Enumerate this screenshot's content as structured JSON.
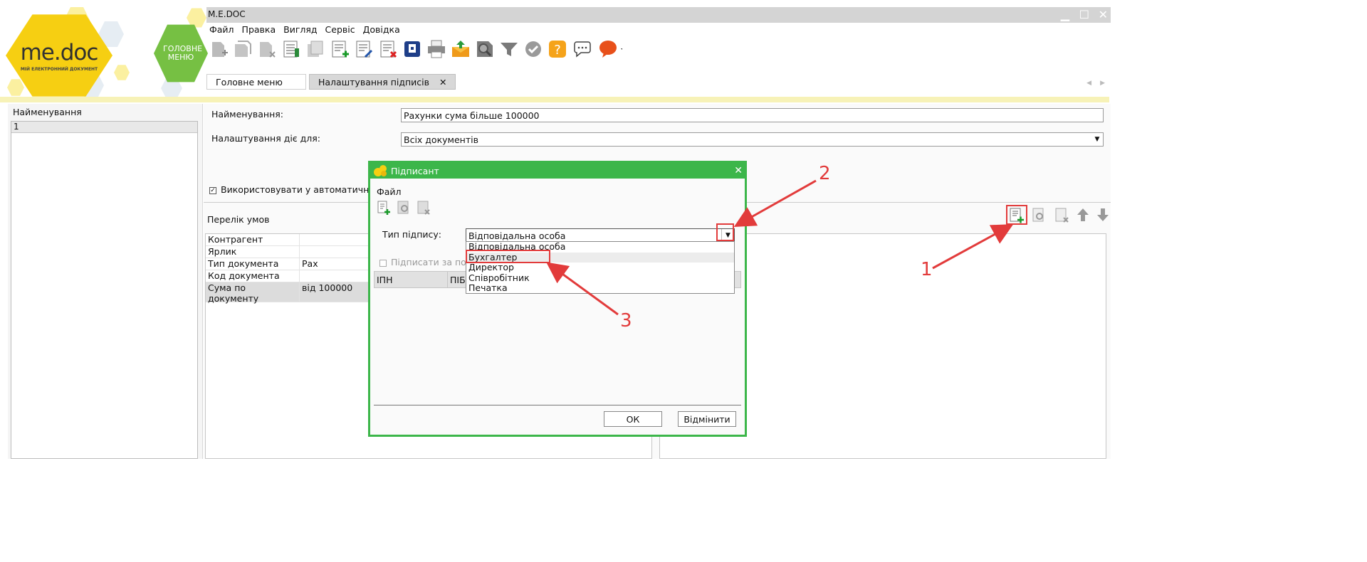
{
  "app": {
    "title": "M.E.DOC",
    "logo_text_me": "me",
    "logo_text_doc": "doc",
    "logo_subtitle": "МІЙ ЕЛЕКТРОННИЙ ДОКУМЕНТ",
    "home_button": "ГОЛОВНЕ МЕНЮ"
  },
  "menu": [
    "Файл",
    "Правка",
    "Вигляд",
    "Сервіс",
    "Довідка"
  ],
  "toolbar_icons": [
    "new-doc-icon",
    "copy-doc-icon",
    "delete-doc-icon",
    "list-icon",
    "duplicate-icon",
    "add-row-icon",
    "edit-row-icon",
    "delete-row-icon",
    "archive-icon",
    "print-icon",
    "send-icon",
    "search-icon",
    "filter-icon",
    "check-icon",
    "help-icon",
    "chat-icon",
    "feedback-icon"
  ],
  "tabs": [
    {
      "label": "Головне меню"
    },
    {
      "label": "Налаштування підписів",
      "close": "✕"
    }
  ],
  "left": {
    "header": "Найменування",
    "rows": [
      "1"
    ]
  },
  "form": {
    "name_label": "Найменування:",
    "name_value": "Рахунки сума більше 100000",
    "applies_label": "Налаштування діє для:",
    "applies_value": "Всіх документів",
    "auto_label": "Використовувати у автоматичн",
    "auto_checked": true,
    "conditions_label": "Перелік умов"
  },
  "conditions": [
    {
      "name": "Контрагент",
      "value": ""
    },
    {
      "name": "Ярлик",
      "value": ""
    },
    {
      "name": "Тип документа",
      "value": "Рах"
    },
    {
      "name": "Код документа",
      "value": ""
    },
    {
      "name": "Сума по документу",
      "value": "від 100000"
    }
  ],
  "dialog": {
    "title": "Підписант",
    "close": "✕",
    "file_label": "Файл",
    "sig_type_label": "Тип підпису:",
    "sig_type_value": "Відповідальна особа",
    "sign_label": "Підписати за пос",
    "col_ipn": "ІПН",
    "col_pib": "ПІБ",
    "ok": "ОК",
    "cancel": "Відмінити",
    "options": [
      "Відповідальна особа",
      "Бухгалтер",
      "Директор",
      "Співробітник",
      "Печатка"
    ],
    "highlighted": "Бухгалтер"
  },
  "annotations": {
    "n1": "1",
    "n2": "2",
    "n3": "3"
  },
  "colors": {
    "accent_green": "#3cb64a",
    "brand_yellow": "#f6cf12",
    "annotation_red": "#e23b3b"
  }
}
